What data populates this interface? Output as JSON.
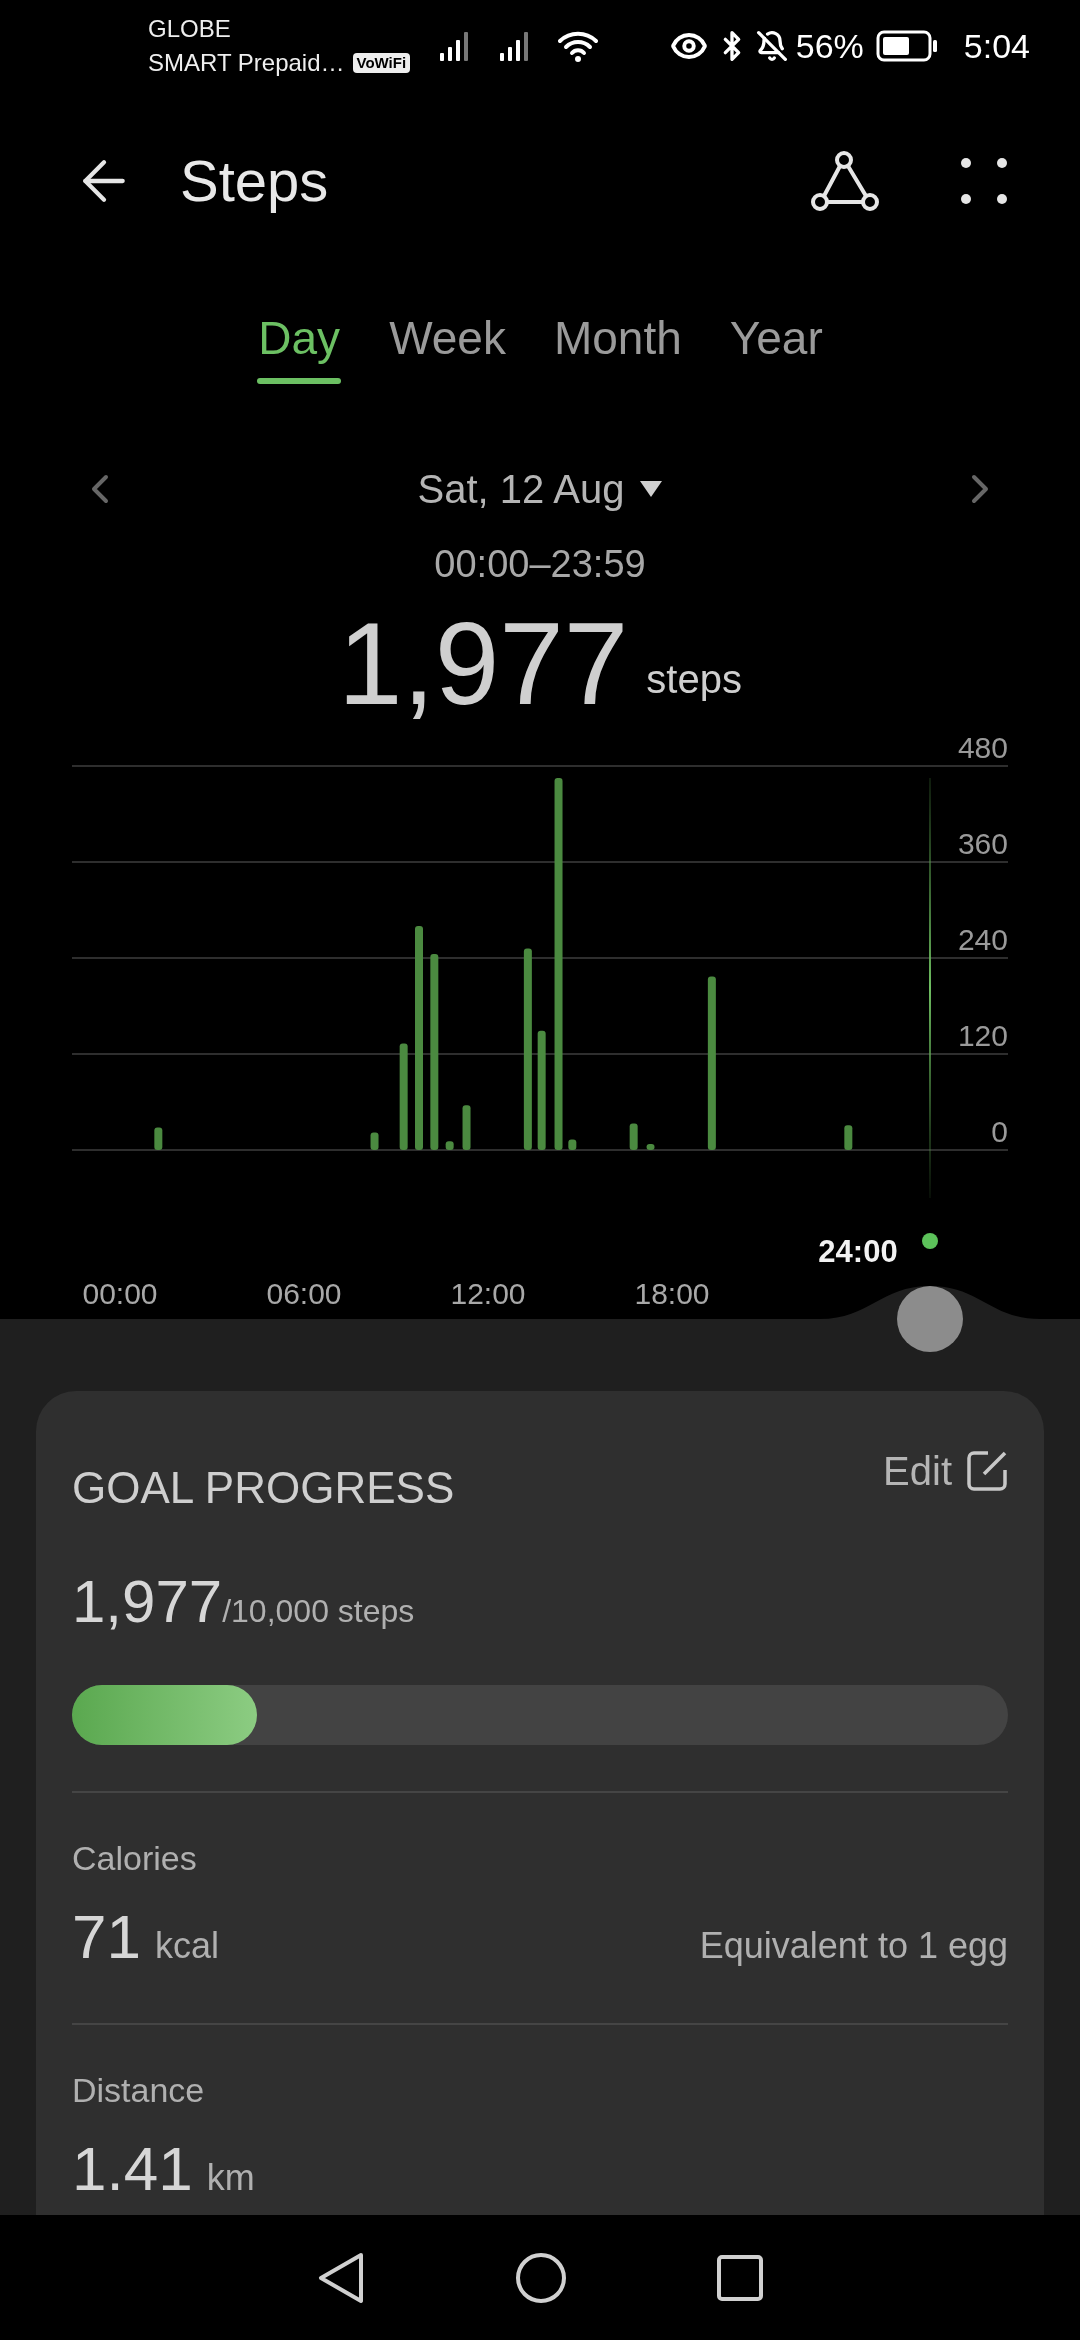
{
  "status_bar": {
    "carrier_1": "GLOBE",
    "carrier_2": "SMART Prepaid…",
    "vowifi_badge": "VoWiFi",
    "battery_percent": "56%",
    "time": "5:04"
  },
  "header": {
    "title": "Steps"
  },
  "tabs": [
    {
      "label": "Day",
      "selected": true
    },
    {
      "label": "Week",
      "selected": false
    },
    {
      "label": "Month",
      "selected": false
    },
    {
      "label": "Year",
      "selected": false
    }
  ],
  "date": {
    "label": "Sat, 12 Aug",
    "range": "00:00–23:59",
    "total": "1,977",
    "unit": "steps"
  },
  "chart": {
    "cursor_label": "24:00",
    "chart_data": {
      "type": "bar",
      "x": [
        1.25,
        8.3,
        9.25,
        9.75,
        10.25,
        10.75,
        11.3,
        13.3,
        13.75,
        14.3,
        14.75,
        16.75,
        17.3,
        19.3,
        23.75
      ],
      "grid": true,
      "series": [
        {
          "color": "#4b8a40",
          "values": [
            28,
            22,
            133,
            280,
            245,
            11,
            56,
            252,
            149,
            465,
            13,
            33,
            7,
            217,
            31
          ]
        }
      ],
      "xlim": [
        0,
        24
      ],
      "ylim": [
        0,
        480
      ],
      "xticks": [
        {
          "value": 0,
          "label": "00:00"
        },
        {
          "value": 6,
          "label": "06:00"
        },
        {
          "value": 12,
          "label": "12:00"
        },
        {
          "value": 18,
          "label": "18:00"
        }
      ],
      "yticks": [
        0,
        120,
        240,
        360,
        480
      ]
    }
  },
  "goal": {
    "title": "GOAL PROGRESS",
    "edit": "Edit",
    "value": "1,977",
    "target": "/10,000 steps",
    "level": 0.1977
  },
  "stats": [
    {
      "label": "Calories",
      "value": "71",
      "unit": "kcal",
      "note": "Equivalent to 1 egg"
    },
    {
      "label": "Distance",
      "value": "1.41",
      "unit": "km"
    }
  ]
}
